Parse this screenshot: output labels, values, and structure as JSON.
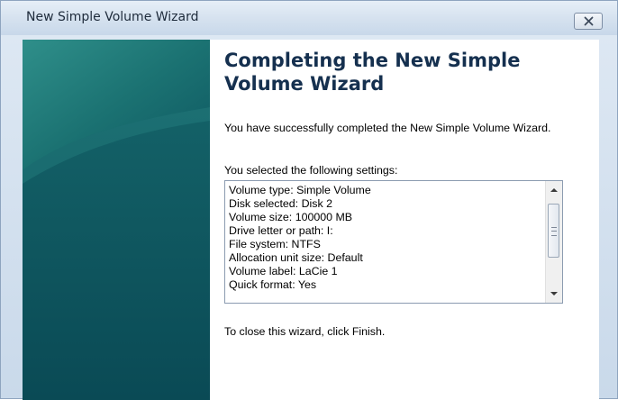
{
  "window": {
    "title": "New Simple Volume Wizard"
  },
  "wizard": {
    "heading": "Completing the New Simple Volume Wizard",
    "success_text": "You have successfully completed the New Simple Volume Wizard.",
    "settings_label": "You selected the following settings:",
    "settings": [
      "Volume type: Simple Volume",
      "Disk selected: Disk 2",
      "Volume size: 100000 MB",
      "Drive letter or path: I:",
      "File system: NTFS",
      "Allocation unit size: Default",
      "Volume label: LaCie 1",
      "Quick format: Yes"
    ],
    "finish_text": "To close this wizard, click Finish."
  },
  "icons": {
    "close": "close-icon",
    "scroll_up": "scroll-up-arrow-icon",
    "scroll_down": "scroll-down-arrow-icon"
  },
  "colors": {
    "side_panel": "#0f5e66",
    "heading": "#15304f"
  }
}
